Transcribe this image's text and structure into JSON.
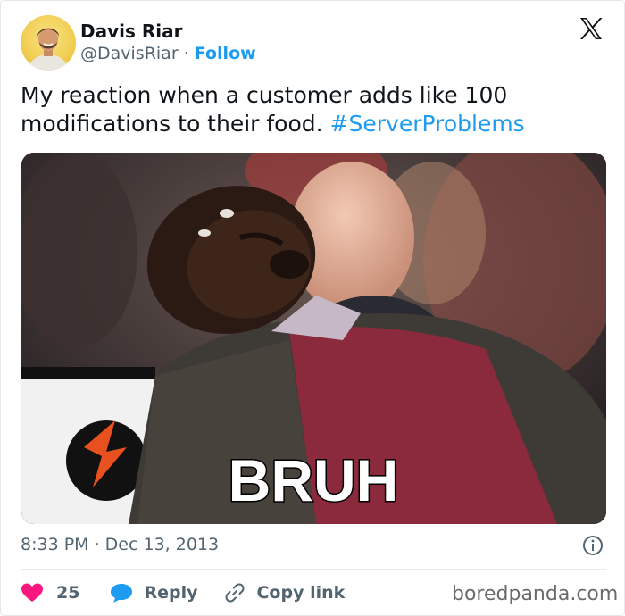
{
  "author": {
    "display_name": "Davis Riar",
    "handle": "@DavisRiar",
    "separator": "·",
    "follow_label": "Follow"
  },
  "tweet": {
    "text": "My reaction when a customer adds like 100 modifications to their food.",
    "hashtag": "#ServerProblems"
  },
  "media": {
    "caption": "BRUH"
  },
  "meta": {
    "timestamp": "8:33 PM · Dec 13, 2013"
  },
  "actions": {
    "like_count": "25",
    "reply_label": "Reply",
    "copy_link_label": "Copy link"
  },
  "watermark": "boredpanda.com",
  "colors": {
    "accent": "#1d9bf0",
    "like": "#f91880",
    "text": "#0f1419",
    "muted": "#536471"
  },
  "icons": [
    "x-logo-icon",
    "info-icon",
    "heart-icon",
    "reply-bubble-icon",
    "link-icon"
  ]
}
